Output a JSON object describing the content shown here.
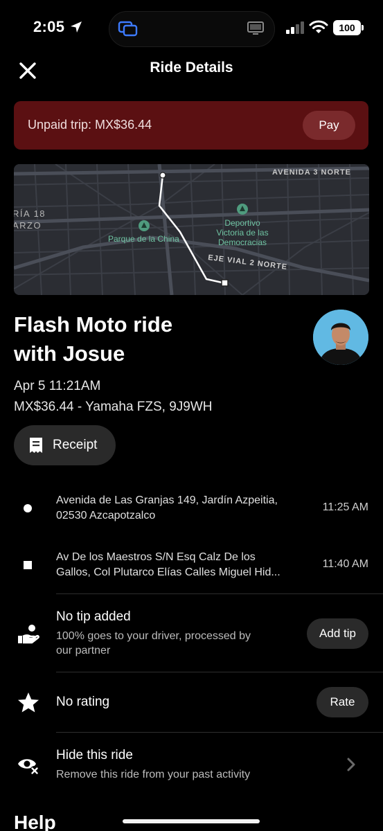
{
  "status_bar": {
    "time": "2:05",
    "battery": "100"
  },
  "header": {
    "title": "Ride Details"
  },
  "banner": {
    "text": "Unpaid trip: MX$36.44",
    "button": "Pay",
    "color": "#5b1012"
  },
  "map": {
    "labels": {
      "street_top": "AVENIDA 3 NORTE",
      "street_mid": "EJE VIAL 2 NORTE",
      "left_1": "RÍA 18",
      "left_2": "ARZO",
      "park_1": "Parque de la China",
      "park_2_line1": "Deportivo",
      "park_2_line2": "Victoria de las",
      "park_2_line3": "Democracias"
    }
  },
  "ride": {
    "title_line1": "Flash Moto ride",
    "title_line2": "with Josue",
    "date": "Apr 5 11:21AM",
    "fare": "MX$36.44 - Yamaha FZS, 9J9WH"
  },
  "receipt_button": "Receipt",
  "stops": [
    {
      "address_line1": "Avenida de Las Granjas 149, Jardín Azpeitia,",
      "address_line2": "02530 Azcapotzalco",
      "time": "11:25 AM"
    },
    {
      "address_line1": "Av De los Maestros S/N Esq Calz De los",
      "address_line2": "Gallos, Col Plutarco Elías Calles Miguel Hid...",
      "time": "11:40 AM"
    }
  ],
  "tip": {
    "title": "No tip added",
    "sub_line1": "100% goes to your driver, processed by",
    "sub_line2": "our partner",
    "button": "Add tip"
  },
  "rating": {
    "title": "No rating",
    "button": "Rate"
  },
  "hide": {
    "title": "Hide this ride",
    "sub": "Remove this ride from your past activity"
  },
  "help": {
    "title": "Help"
  }
}
